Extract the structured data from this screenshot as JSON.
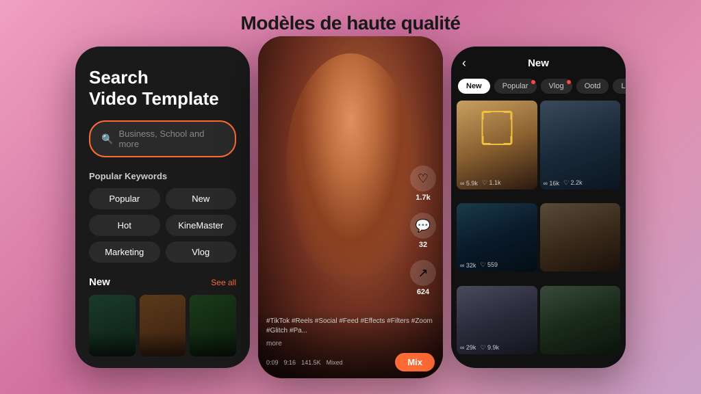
{
  "page": {
    "title": "Modèles de haute qualité"
  },
  "phone1": {
    "search_title": "Search\nVideo Template",
    "search_placeholder": "Business, School and more",
    "keywords_label": "Popular Keywords",
    "keywords": [
      "Popular",
      "New",
      "Hot",
      "KineMaster",
      "Marketing",
      "Vlog"
    ],
    "new_label": "New",
    "see_all": "See all"
  },
  "phone2": {
    "tags": "#TikTok #Reels #Social #Feed #Effects #Filters #Zoom #Glitch #Pa...",
    "more": "more",
    "duration": "0:09",
    "ratio": "9:16",
    "views": "141.5K",
    "type": "Mixed",
    "mix_label": "Mix",
    "like_count": "1.7k",
    "comment_count": "32",
    "share_count": "624"
  },
  "phone3": {
    "title": "New",
    "back": "‹",
    "categories": [
      "New",
      "Popular",
      "Vlog",
      "Ootd",
      "Lab"
    ],
    "active_category": "New",
    "items": [
      {
        "stats": {
          "views": "5.9k",
          "likes": "1.1k"
        }
      },
      {
        "stats": {
          "views": "16k",
          "likes": "2.2k"
        }
      },
      {
        "stats": {
          "views": "32k",
          "likes": "559"
        }
      },
      {
        "stats": {
          "views": "",
          "likes": ""
        }
      },
      {
        "stats": {
          "views": "29k",
          "likes": "9.9k"
        }
      },
      {
        "stats": {
          "views": "",
          "likes": ""
        }
      }
    ]
  },
  "icons": {
    "search": "🔍",
    "heart": "♡",
    "comment": "💬",
    "share": "↗",
    "back": "‹",
    "views": "∞",
    "likes": "♡"
  }
}
